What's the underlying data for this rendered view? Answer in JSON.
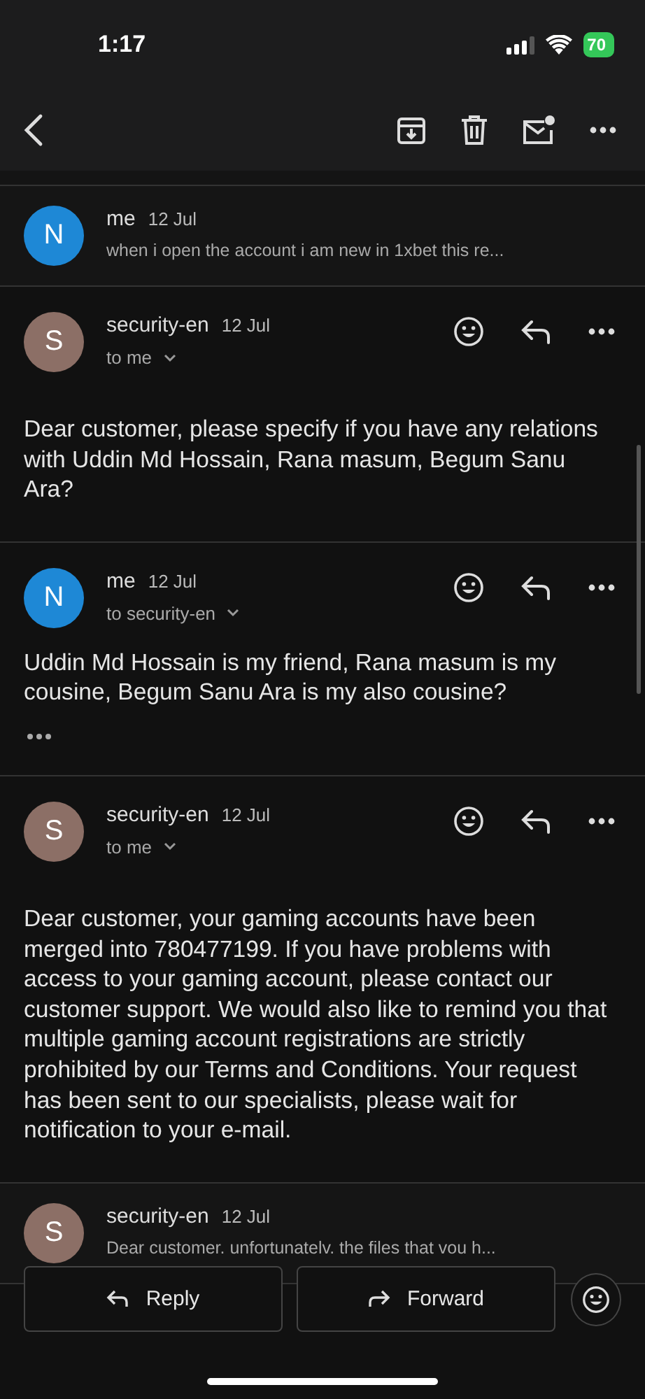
{
  "status_bar": {
    "time": "1:17",
    "battery": "70"
  },
  "messages": [
    {
      "kind": "collapsed",
      "avatar": "N",
      "color": "#1e88d6",
      "sender": "me",
      "date": "12 Jul",
      "snippet": "when i open the account i am new in 1xbet this re..."
    },
    {
      "kind": "expanded",
      "avatar": "S",
      "color": "#8c6f66",
      "sender": "security-en",
      "date": "12 Jul",
      "recipient": "to me",
      "body": "Dear customer, please specify if you have any relations with Uddin Md Hossain, Rana masum, Begum Sanu Ara?",
      "trimmed": false
    },
    {
      "kind": "expanded",
      "avatar": "N",
      "color": "#1e88d6",
      "sender": "me",
      "date": "12 Jul",
      "recipient": "to security-en",
      "body": "Uddin Md Hossain is my friend, Rana masum is my cousine, Begum Sanu Ara is my also cousine?",
      "trimmed": true
    },
    {
      "kind": "expanded",
      "avatar": "S",
      "color": "#8c6f66",
      "sender": "security-en",
      "date": "12 Jul",
      "recipient": "to me",
      "body": "Dear customer, your gaming accounts have been merged into 780477199. If you have problems with access to your gaming account, please contact our customer support. We would also like to remind you that multiple gaming account registrations are strictly prohibited by our Terms and Conditions. Your request has been sent to our specialists, please wait for notification to your e-mail.",
      "trimmed": false
    },
    {
      "kind": "collapsed",
      "avatar": "S",
      "color": "#8c6f66",
      "sender": "security-en",
      "date": "12 Jul",
      "snippet": "Dear customer. unfortunatelv. the files that vou h..."
    }
  ],
  "actions": {
    "reply": "Reply",
    "forward": "Forward"
  }
}
